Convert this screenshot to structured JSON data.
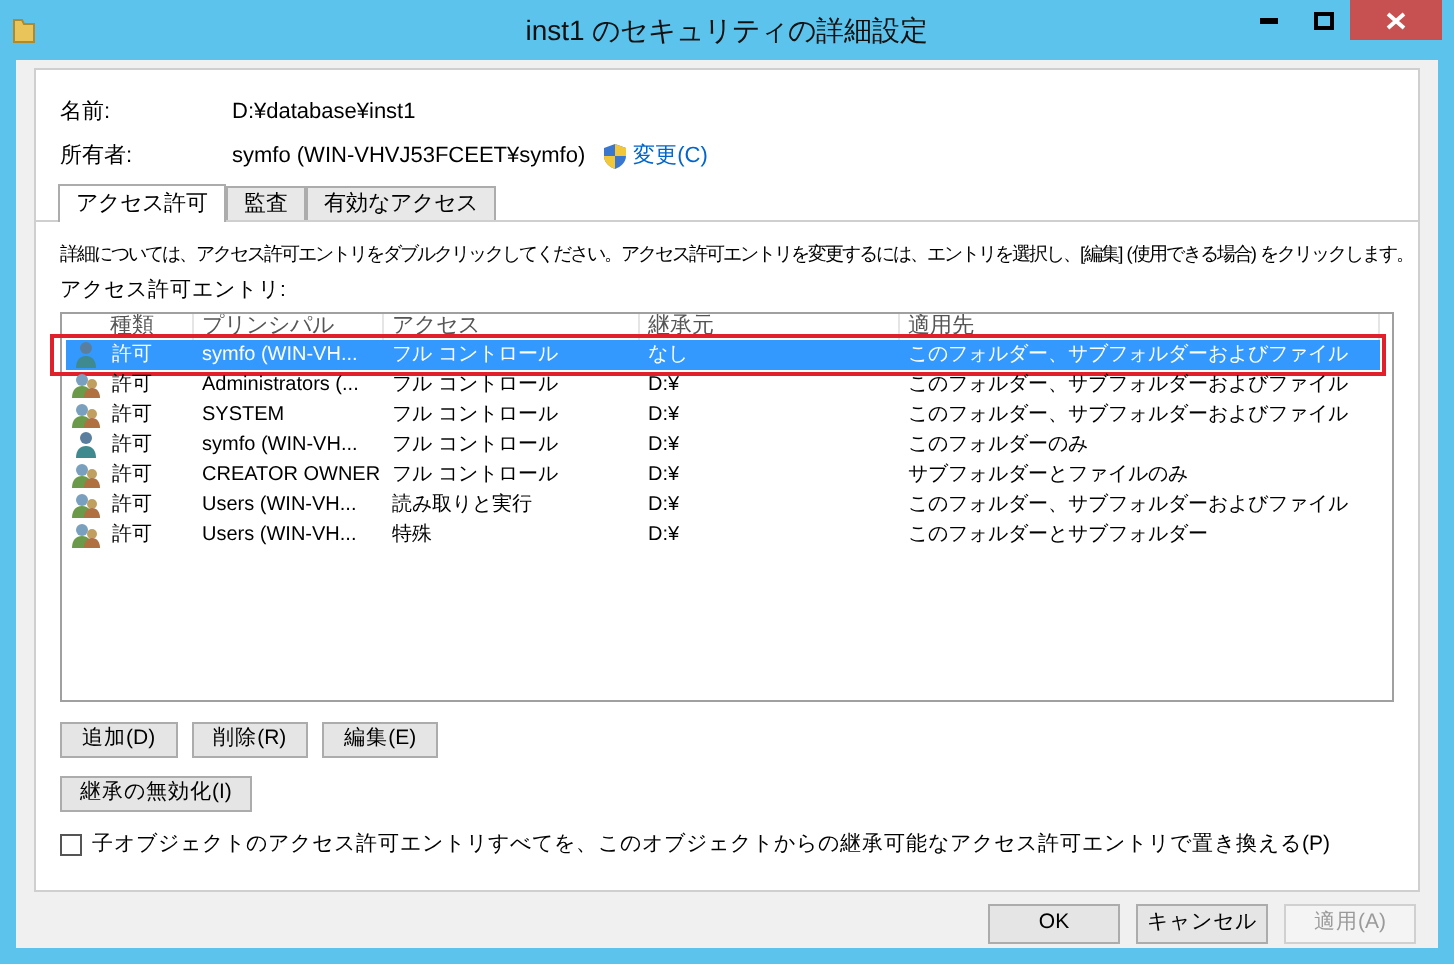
{
  "window": {
    "title": "inst1 のセキュリティの詳細設定"
  },
  "info": {
    "name_label": "名前:",
    "name_value": "D:¥database¥inst1",
    "owner_label": "所有者:",
    "owner_value": "symfo (WIN-VHVJ53FCEET¥symfo)",
    "change_link": "変更(C)"
  },
  "tabs": [
    {
      "label": "アクセス許可",
      "selected": true
    },
    {
      "label": "監査",
      "selected": false
    },
    {
      "label": "有効なアクセス",
      "selected": false
    }
  ],
  "description": "詳細については、アクセス許可エントリをダブルクリックしてください。アクセス許可エントリを変更するには、エントリを選択し、[編集] (使用できる場合) をクリックします。",
  "list_label": "アクセス許可エントリ:",
  "table": {
    "columns": [
      "種類",
      "プリンシパル",
      "アクセス",
      "継承元",
      "適用先"
    ],
    "rows": [
      {
        "kind": "user",
        "selected": true,
        "highlighted": true,
        "cells": [
          "許可",
          "symfo (WIN-VH...",
          "フル コントロール",
          "なし",
          "このフォルダー、サブフォルダーおよびファイル"
        ]
      },
      {
        "kind": "group",
        "selected": false,
        "highlighted": false,
        "cells": [
          "許可",
          "Administrators (...",
          "フル コントロール",
          "D:¥",
          "このフォルダー、サブフォルダーおよびファイル"
        ]
      },
      {
        "kind": "group",
        "selected": false,
        "highlighted": false,
        "cells": [
          "許可",
          "SYSTEM",
          "フル コントロール",
          "D:¥",
          "このフォルダー、サブフォルダーおよびファイル"
        ]
      },
      {
        "kind": "user",
        "selected": false,
        "highlighted": false,
        "cells": [
          "許可",
          "symfo (WIN-VH...",
          "フル コントロール",
          "D:¥",
          "このフォルダーのみ"
        ]
      },
      {
        "kind": "group",
        "selected": false,
        "highlighted": false,
        "cells": [
          "許可",
          "CREATOR OWNER",
          "フル コントロール",
          "D:¥",
          "サブフォルダーとファイルのみ"
        ]
      },
      {
        "kind": "group",
        "selected": false,
        "highlighted": false,
        "cells": [
          "許可",
          "Users (WIN-VH...",
          "読み取りと実行",
          "D:¥",
          "このフォルダー、サブフォルダーおよびファイル"
        ]
      },
      {
        "kind": "group",
        "selected": false,
        "highlighted": false,
        "cells": [
          "許可",
          "Users (WIN-VH...",
          "特殊",
          "D:¥",
          "このフォルダーとサブフォルダー"
        ]
      }
    ]
  },
  "entry_buttons": [
    "追加(D)",
    "削除(R)",
    "編集(E)"
  ],
  "inherit_button": "継承の無効化(I)",
  "replace_checkbox": {
    "label": "子オブジェクトのアクセス許可エントリすべてを、このオブジェクトからの継承可能なアクセス許可エントリで置き換える(P)",
    "checked": false
  },
  "dialog_buttons": [
    {
      "label": "OK",
      "disabled": false
    },
    {
      "label": "キャンセル",
      "disabled": false
    },
    {
      "label": "適用(A)",
      "disabled": true
    }
  ]
}
